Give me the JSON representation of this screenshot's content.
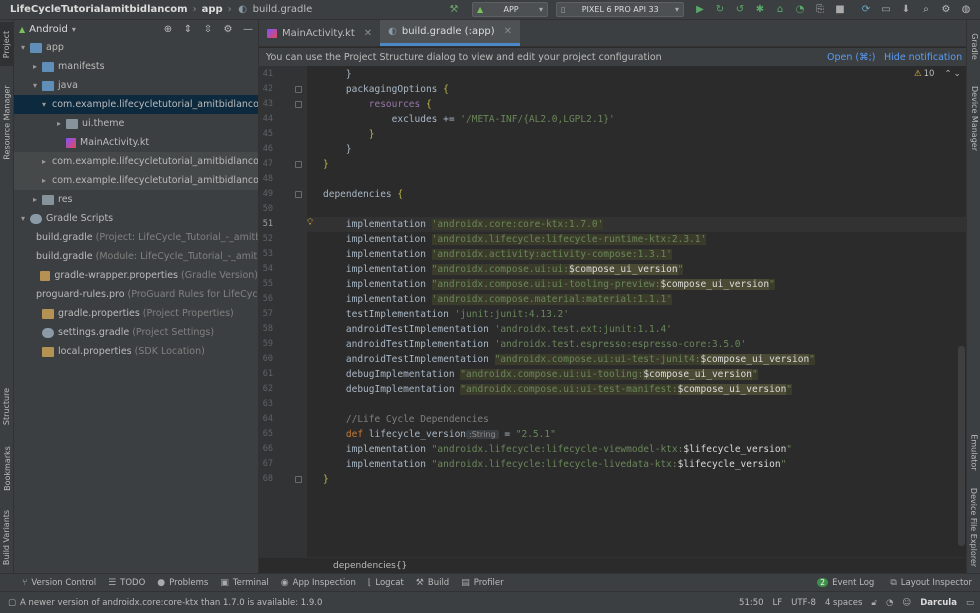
{
  "breadcrumbs": [
    "LifeCycleTutorialamitbidlancom",
    "app",
    "build.gradle"
  ],
  "run_config": "APP",
  "device": "PIXEL 6 PRO API 33",
  "project_panel": {
    "view": "Android",
    "tree": [
      {
        "label": "app",
        "extra": "",
        "level": 0,
        "icon": "folder-blue",
        "arrow": "▾"
      },
      {
        "label": "manifests",
        "extra": "",
        "level": 1,
        "icon": "folder-blue",
        "arrow": "▸"
      },
      {
        "label": "java",
        "extra": "",
        "level": 1,
        "icon": "folder-blue",
        "arrow": "▾"
      },
      {
        "label": "com.example.lifecycletutorial_amitbidlancom",
        "extra": "",
        "level": 2,
        "icon": "package",
        "arrow": "▾",
        "state": "selected"
      },
      {
        "label": "ui.theme",
        "extra": "",
        "level": 3,
        "icon": "package",
        "arrow": "▸"
      },
      {
        "label": "MainActivity.kt",
        "extra": "",
        "level": 3,
        "icon": "kotlin",
        "arrow": ""
      },
      {
        "label": "com.example.lifecycletutorial_amitbidlancom",
        "extra": "",
        "level": 2,
        "icon": "package",
        "arrow": "▸",
        "state": "hl"
      },
      {
        "label": "com.example.lifecycletutorial_amitbidlancom",
        "extra": "",
        "level": 2,
        "icon": "package",
        "arrow": "▸",
        "state": "hl"
      },
      {
        "label": "res",
        "extra": "",
        "level": 1,
        "icon": "folder",
        "arrow": "▸"
      },
      {
        "label": "Gradle Scripts",
        "extra": "",
        "level": 0,
        "icon": "gradle",
        "arrow": "▾"
      },
      {
        "label": "build.gradle",
        "extra": "(Project: LifeCycle_Tutorial_-_amitbi",
        "level": 1,
        "icon": "gradle",
        "arrow": ""
      },
      {
        "label": "build.gradle",
        "extra": "(Module: LifeCycle_Tutorial_-_amitb",
        "level": 1,
        "icon": "gradle",
        "arrow": ""
      },
      {
        "label": "gradle-wrapper.properties",
        "extra": "(Gradle Version)",
        "level": 1,
        "icon": "props",
        "arrow": ""
      },
      {
        "label": "proguard-rules.pro",
        "extra": "(ProGuard Rules for LifeCycle",
        "level": 1,
        "icon": "props",
        "arrow": ""
      },
      {
        "label": "gradle.properties",
        "extra": "(Project Properties)",
        "level": 1,
        "icon": "props",
        "arrow": ""
      },
      {
        "label": "settings.gradle",
        "extra": "(Project Settings)",
        "level": 1,
        "icon": "gradle",
        "arrow": ""
      },
      {
        "label": "local.properties",
        "extra": "(SDK Location)",
        "level": 1,
        "icon": "props",
        "arrow": ""
      }
    ]
  },
  "left_stripe": [
    "Project",
    "Resource Manager",
    "Structure",
    "Bookmarks",
    "Build Variants"
  ],
  "right_stripe": [
    "Gradle",
    "Device Manager",
    "Emulator",
    "Device File Explorer"
  ],
  "tabs": [
    {
      "label": "MainActivity.kt",
      "active": false
    },
    {
      "label": "build.gradle (:app)",
      "active": true
    }
  ],
  "notification": {
    "text": "You can use the Project Structure dialog to view and edit your project configuration",
    "open": "Open (⌘;)",
    "hide": "Hide notification"
  },
  "warnings": "10",
  "editor_lines": [
    {
      "n": "41",
      "tokens": [
        [
          "    }",
          "c"
        ]
      ]
    },
    {
      "n": "42",
      "tokens": [
        [
          "    packagingOptions ",
          "c"
        ],
        [
          "{",
          "b"
        ]
      ]
    },
    {
      "n": "43",
      "tokens": [
        [
          "        resources ",
          "p"
        ],
        [
          "{",
          "b"
        ]
      ]
    },
    {
      "n": "44",
      "tokens": [
        [
          "            excludes += ",
          "c"
        ],
        [
          "'/META-INF/{AL2.0,LGPL2.1}'",
          "s"
        ]
      ]
    },
    {
      "n": "45",
      "tokens": [
        [
          "        }",
          "b"
        ]
      ]
    },
    {
      "n": "46",
      "tokens": [
        [
          "    }",
          "c"
        ]
      ]
    },
    {
      "n": "47",
      "tokens": [
        [
          "}",
          "b"
        ]
      ]
    },
    {
      "n": "48",
      "tokens": []
    },
    {
      "n": "49",
      "tokens": [
        [
          "dependencies ",
          "c"
        ],
        [
          "{",
          "b"
        ]
      ]
    },
    {
      "n": "50",
      "tokens": []
    },
    {
      "n": "51",
      "tokens": [
        [
          "    implementation ",
          "c"
        ],
        [
          "'androidx.core:core-ktx:1.7.0'",
          "sh"
        ]
      ],
      "current": true
    },
    {
      "n": "52",
      "tokens": [
        [
          "    implementation ",
          "c"
        ],
        [
          "'androidx.lifecycle:lifecycle-runtime-ktx:2.3.1'",
          "sh"
        ]
      ]
    },
    {
      "n": "53",
      "tokens": [
        [
          "    implementation ",
          "c"
        ],
        [
          "'androidx.activity:activity-compose:1.3.1'",
          "sh"
        ]
      ]
    },
    {
      "n": "54",
      "tokens": [
        [
          "    implementation ",
          "c"
        ],
        [
          "\"androidx.compose.ui:ui:",
          "sh"
        ],
        [
          "$compose_ui_version",
          "vh"
        ],
        [
          "\"",
          "sh"
        ]
      ]
    },
    {
      "n": "55",
      "tokens": [
        [
          "    implementation ",
          "c"
        ],
        [
          "\"androidx.compose.ui:ui-tooling-preview:",
          "sh"
        ],
        [
          "$compose_ui_version",
          "vh"
        ],
        [
          "\"",
          "sh"
        ]
      ]
    },
    {
      "n": "56",
      "tokens": [
        [
          "    implementation ",
          "c"
        ],
        [
          "'androidx.compose.material:material:1.1.1'",
          "sh"
        ]
      ]
    },
    {
      "n": "57",
      "tokens": [
        [
          "    testImplementation ",
          "c"
        ],
        [
          "'junit:junit:4.13.2'",
          "s"
        ]
      ]
    },
    {
      "n": "58",
      "tokens": [
        [
          "    androidTestImplementation ",
          "c"
        ],
        [
          "'androidx.test.ext:junit:1.1.4'",
          "s"
        ]
      ]
    },
    {
      "n": "59",
      "tokens": [
        [
          "    androidTestImplementation ",
          "c"
        ],
        [
          "'androidx.test.espresso:espresso-core:3.5.0'",
          "s"
        ]
      ]
    },
    {
      "n": "60",
      "tokens": [
        [
          "    androidTestImplementation ",
          "c"
        ],
        [
          "\"androidx.compose.ui:ui-test-junit4:",
          "sh"
        ],
        [
          "$compose_ui_version",
          "vh"
        ],
        [
          "\"",
          "sh"
        ]
      ]
    },
    {
      "n": "61",
      "tokens": [
        [
          "    debugImplementation ",
          "c"
        ],
        [
          "\"androidx.compose.ui:ui-tooling:",
          "sh"
        ],
        [
          "$compose_ui_version",
          "vh"
        ],
        [
          "\"",
          "sh"
        ]
      ]
    },
    {
      "n": "62",
      "tokens": [
        [
          "    debugImplementation ",
          "c"
        ],
        [
          "\"androidx.compose.ui:ui-test-manifest:",
          "sh"
        ],
        [
          "$compose_ui_version",
          "vh"
        ],
        [
          "\"",
          "sh"
        ]
      ]
    },
    {
      "n": "63",
      "tokens": []
    },
    {
      "n": "64",
      "tokens": [
        [
          "    //Life Cycle Dependencies",
          "m"
        ]
      ]
    },
    {
      "n": "65",
      "tokens": [
        [
          "    ",
          "c"
        ],
        [
          "def",
          "k"
        ],
        [
          " lifecycle_version",
          "c"
        ],
        [
          ":String",
          "h"
        ],
        [
          " = ",
          "c"
        ],
        [
          "\"2.5.1\"",
          "s"
        ]
      ]
    },
    {
      "n": "66",
      "tokens": [
        [
          "    implementation ",
          "c"
        ],
        [
          "\"androidx.lifecycle:lifecycle-viewmodel-ktx:",
          "s"
        ],
        [
          "$lifecycle_version",
          "v"
        ],
        [
          "\"",
          "s"
        ]
      ]
    },
    {
      "n": "67",
      "tokens": [
        [
          "    implementation ",
          "c"
        ],
        [
          "\"androidx.lifecycle:lifecycle-livedata-ktx:",
          "s"
        ],
        [
          "$lifecycle_version",
          "v"
        ],
        [
          "\"",
          "s"
        ]
      ]
    },
    {
      "n": "68",
      "tokens": [
        [
          "}",
          "b"
        ]
      ]
    }
  ],
  "editor_breadcrumb": "dependencies{}",
  "bottom_tools": [
    "Version Control",
    "TODO",
    "Problems",
    "Terminal",
    "App Inspection",
    "Logcat",
    "Build",
    "Profiler"
  ],
  "bottom_right_tools": [
    "Event Log",
    "Layout Inspector"
  ],
  "event_log_count": "2",
  "status": {
    "message": "A newer version of androidx.core:core-ktx than 1.7.0 is available: 1.9.0",
    "position": "51:50",
    "line_sep": "LF",
    "encoding": "UTF-8",
    "indent": "4 spaces",
    "theme": "Darcula"
  }
}
